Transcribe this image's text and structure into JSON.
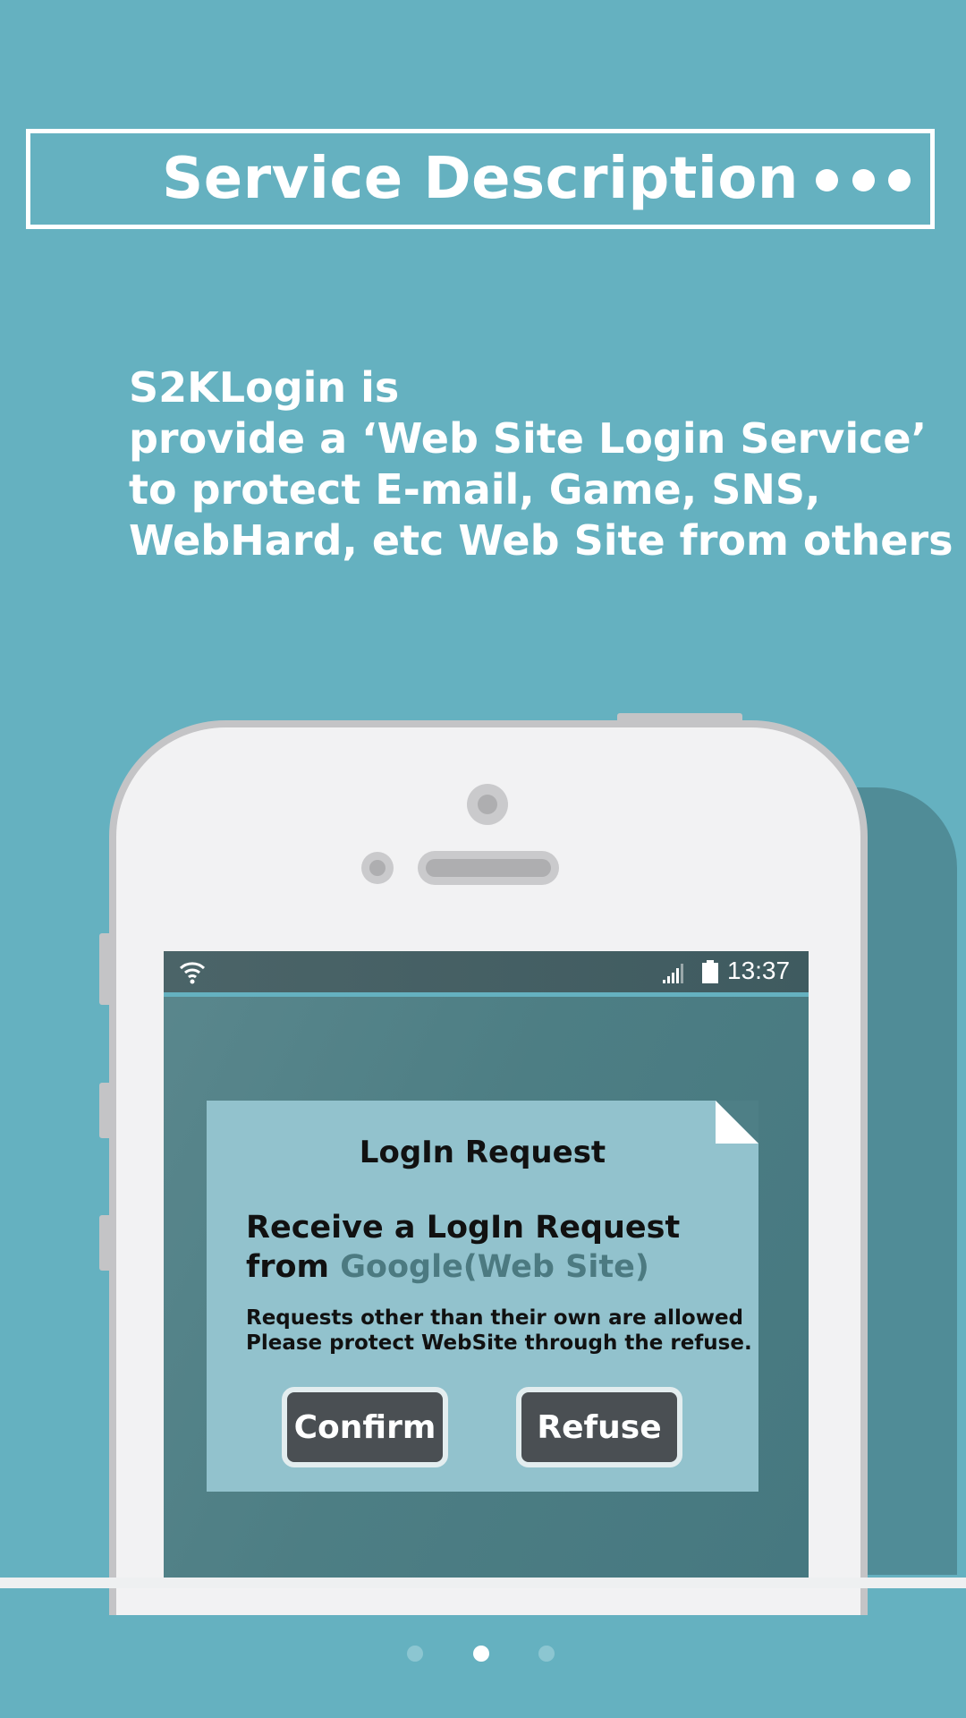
{
  "header": {
    "title": "Service Description",
    "more_icon": "more-horizontal-icon"
  },
  "description": {
    "lines": [
      "S2KLogin is",
      "provide a ‘Web Site Login Service’",
      "to protect E-mail, Game, SNS,",
      "WebHard, etc Web Site from others"
    ]
  },
  "phone": {
    "statusbar": {
      "wifi_icon": "wifi-icon",
      "signal_icon": "signal-icon",
      "battery_icon": "battery-icon",
      "time": "13:37"
    },
    "dialog": {
      "title": "LogIn Request",
      "message_line1": "Receive a LogIn Request",
      "message_prefix": "from ",
      "site": "Google(Web Site)",
      "note_line1": "Requests other than their own are allowed",
      "note_line2": "Please protect WebSite through the refuse.",
      "confirm_label": "Confirm",
      "refuse_label": "Refuse"
    }
  },
  "pager": {
    "count": 3,
    "active_index": 1
  },
  "colors": {
    "background": "#65b1c0",
    "dialog": "#92c2cd",
    "button": "#4a4f53",
    "site_highlight": "#4c7a81"
  }
}
